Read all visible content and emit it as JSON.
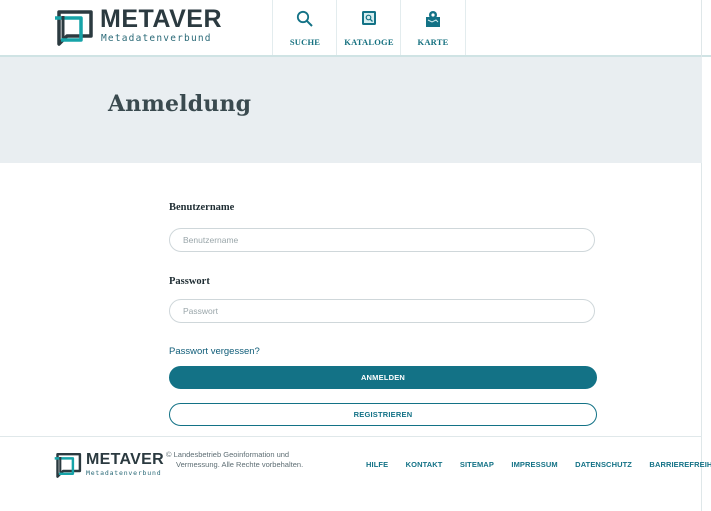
{
  "header": {
    "logo_title": "METAVER",
    "logo_subtitle": "Metadatenverbund",
    "nav": [
      {
        "label": "SUCHE",
        "icon": "search-icon"
      },
      {
        "label": "KATALOGE",
        "icon": "catalog-icon"
      },
      {
        "label": "KARTE",
        "icon": "map-icon"
      }
    ]
  },
  "page": {
    "title": "Anmeldung"
  },
  "form": {
    "username_label": "Benutzername",
    "username_placeholder": "Benutzername",
    "password_label": "Passwort",
    "password_placeholder": "Passwort",
    "forgot_link": "Passwort vergessen?",
    "login_button": "ANMELDEN",
    "register_button": "REGISTRIEREN"
  },
  "footer": {
    "logo_title": "METAVER",
    "logo_subtitle": "Metadatenverbund",
    "copyright_line1": "© Landesbetrieb Geoinformation und",
    "copyright_line2": "Vermessung. Alle Rechte vorbehalten.",
    "links": [
      "HILFE",
      "KONTAKT",
      "SITEMAP",
      "IMPRESSUM",
      "DATENSCHUTZ",
      "BARRIEREFREIHEIT"
    ]
  },
  "colors": {
    "accent": "#137286",
    "band_background": "#e9eef1",
    "title_text": "#3a4a4f"
  }
}
